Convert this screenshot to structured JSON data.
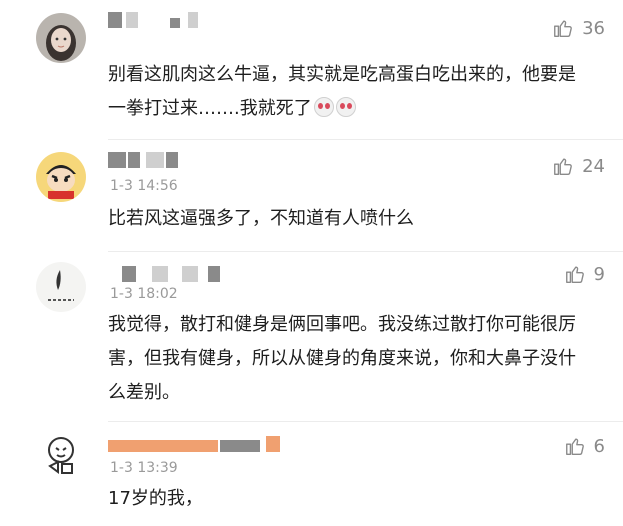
{
  "comments": [
    {
      "time": "",
      "text": "别看这肌肉这么牛逼，其实就是吃高蛋白吃出来的，他要是一拳打过来…….我就死了",
      "emojis": [
        "scared-face-icon",
        "scared-face-icon"
      ],
      "likes": "36"
    },
    {
      "time": "1-3 14:56",
      "text": "比若风这逼强多了，不知道有人喷什么",
      "likes": "24"
    },
    {
      "time": "1-3 18:02",
      "text": "我觉得，散打和健身是俩回事吧。我没练过散打你可能很厉害，但我有健身，所以从健身的角度来说，你和大鼻子没什么差别。",
      "likes": "9"
    },
    {
      "time": "1-3 13:39",
      "text": "17岁的我，",
      "likes": "6"
    }
  ],
  "colors": {
    "text": "#1e1e1e",
    "meta": "#9a9a9a",
    "mask": "#8a8a8a",
    "mask_orange": "#f0a070"
  }
}
